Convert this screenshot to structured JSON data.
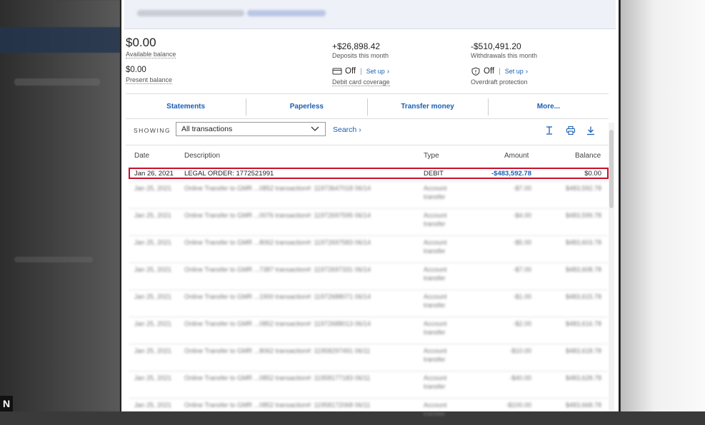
{
  "account": {
    "available_balance": "$0.00",
    "available_balance_label": "Available balance",
    "present_balance": "$0.00",
    "present_balance_label": "Present balance",
    "deposits": "+$26,898.42",
    "deposits_label": "Deposits this month",
    "withdrawals": "-$510,491.20",
    "withdrawals_label": "Withdrawals this month",
    "debit_card_status": "Off",
    "debit_card_setup": "Set up",
    "debit_card_label": "Debit card coverage",
    "overdraft_status": "Off",
    "overdraft_setup": "Set up",
    "overdraft_label": "Overdraft protection"
  },
  "tabs": [
    "Statements",
    "Paperless",
    "Transfer money",
    "More..."
  ],
  "filter": {
    "showing_label": "SHOWING",
    "selected": "All transactions",
    "search_label": "Search"
  },
  "table": {
    "headers": {
      "date": "Date",
      "description": "Description",
      "type": "Type",
      "amount": "Amount",
      "balance": "Balance"
    },
    "highlighted": {
      "date": "Jan 26, 2021",
      "description": "LEGAL ORDER: 1772521991",
      "type": "DEBIT",
      "amount": "-$483,592.78",
      "balance": "$0.00"
    },
    "rows": [
      {
        "date": "Jan 25, 2021",
        "description": "Online Transfer to GMR ...0852 transaction#: 11973647018 06/14",
        "type1": "Account",
        "type2": "transfer",
        "amount": "-$7.00",
        "balance": "$483,592.78"
      },
      {
        "date": "Jan 25, 2021",
        "description": "Online Transfer to GMR ...0076 transaction#: 11972697595 06/14",
        "type1": "Account",
        "type2": "transfer",
        "amount": "-$4.00",
        "balance": "$483,599.78"
      },
      {
        "date": "Jan 25, 2021",
        "description": "Online Transfer to GMR ...8062 transaction#: 11972697583 06/14",
        "type1": "Account",
        "type2": "transfer",
        "amount": "-$5.00",
        "balance": "$483,603.78"
      },
      {
        "date": "Jan 25, 2021",
        "description": "Online Transfer to GMR ...7387 transaction#: 11972697331 06/14",
        "type1": "Account",
        "type2": "transfer",
        "amount": "-$7.00",
        "balance": "$483,608.78"
      },
      {
        "date": "Jan 25, 2021",
        "description": "Online Transfer to GMR ...1900 transaction#: 11972688071 06/14",
        "type1": "Account",
        "type2": "transfer",
        "amount": "-$1.00",
        "balance": "$483,615.78"
      },
      {
        "date": "Jan 25, 2021",
        "description": "Online Transfer to GMR ...0852 transaction#: 11972688013 06/14",
        "type1": "Account",
        "type2": "transfer",
        "amount": "-$2.00",
        "balance": "$483,616.78"
      },
      {
        "date": "Jan 25, 2021",
        "description": "Online Transfer to GMR ...8062 transaction#: 11958297491 06/11",
        "type1": "Account",
        "type2": "transfer",
        "amount": "-$10.00",
        "balance": "$483,618.78"
      },
      {
        "date": "Jan 25, 2021",
        "description": "Online Transfer to GMR ...0852 transaction#: 11958177183 06/11",
        "type1": "Account",
        "type2": "transfer",
        "amount": "-$40.00",
        "balance": "$483,628.78"
      },
      {
        "date": "Jan 25, 2021",
        "description": "Online Transfer to GMR ...0852 transaction#: 11958172068 06/11",
        "type1": "Account",
        "type2": "transfer",
        "amount": "-$100.00",
        "balance": "$483,668.78"
      }
    ]
  },
  "corner_tag": "N",
  "colors": {
    "link": "#1a5fb4",
    "highlight": "#c8102e"
  }
}
